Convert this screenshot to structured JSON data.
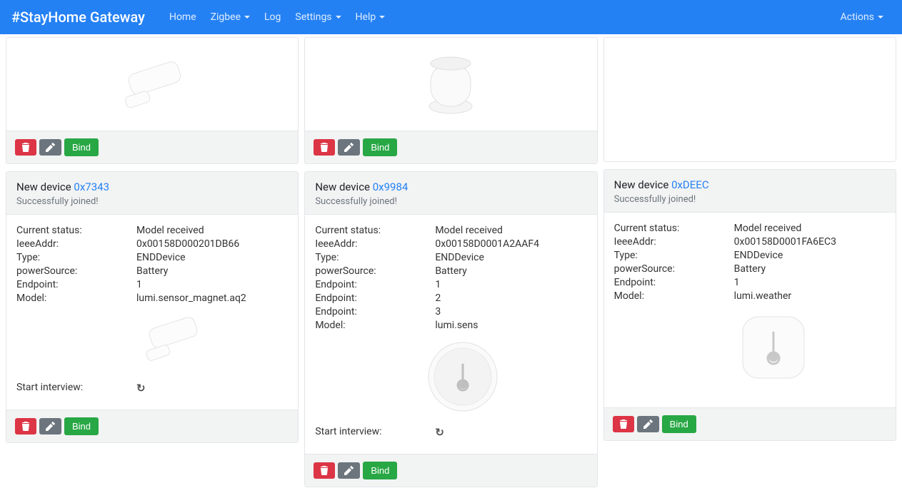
{
  "navbar": {
    "brand": "#StayHome Gateway",
    "links": [
      "Home",
      "Zigbee",
      "Log",
      "Settings",
      "Help"
    ],
    "actions": "Actions"
  },
  "labels": {
    "bind": "Bind",
    "new_device_prefix": "New device ",
    "joined": "Successfully joined!",
    "current_status": "Current status:",
    "ieee": "IeeeAddr:",
    "type": "Type:",
    "power": "powerSource:",
    "endpoint": "Endpoint:",
    "model": "Model:",
    "start_interview": "Start interview:"
  },
  "devices": [
    {
      "addr": "0x7343",
      "status": "Model received",
      "ieee": "0x00158D000201DB66",
      "type": "ENDDevice",
      "power": "Battery",
      "endpoints": [
        "1"
      ],
      "model": "lumi.sensor_magnet.aq2",
      "image": "contact",
      "show_interview": true
    },
    {
      "addr": "0x9984",
      "status": "Model received",
      "ieee": "0x00158D0001A2AAF4",
      "type": "ENDDevice",
      "power": "Battery",
      "endpoints": [
        "1",
        "2",
        "3"
      ],
      "model": "lumi.sens",
      "image": "motion_round",
      "show_interview": true
    },
    {
      "addr": "0xDEEC",
      "status": "Model received",
      "ieee": "0x00158D0001FA6EC3",
      "type": "ENDDevice",
      "power": "Battery",
      "endpoints": [
        "1"
      ],
      "model": "lumi.weather",
      "image": "weather",
      "show_interview": false
    }
  ],
  "top_images": [
    "contact",
    "motion_cyl",
    "blank"
  ]
}
